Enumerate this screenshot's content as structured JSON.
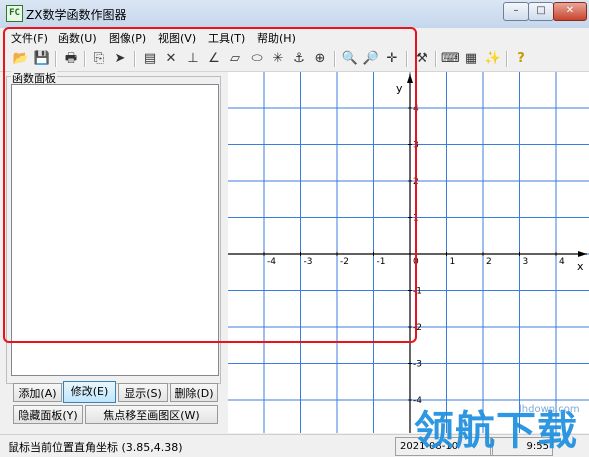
{
  "window": {
    "title": "ZX数学函数作图器",
    "app_icon_text": "FC",
    "min_glyph": "–",
    "max_glyph": "□",
    "close_glyph": "✕"
  },
  "menu": [
    "文件(F)",
    "函数(U)",
    "图像(P)",
    "视图(V)",
    "工具(T)",
    "帮助(H)"
  ],
  "toolbar": [
    {
      "icon": "open-folder-icon",
      "glyph": "📂"
    },
    {
      "icon": "save-icon",
      "glyph": "💾"
    },
    {
      "icon": "print-icon",
      "glyph": "🖶"
    },
    {
      "icon": "copy-icon",
      "glyph": "⎘"
    },
    {
      "icon": "export-icon",
      "glyph": "➤"
    },
    {
      "icon": "window-icon",
      "glyph": "▤"
    },
    {
      "icon": "intersect-icon",
      "glyph": "✕"
    },
    {
      "icon": "axis-icon",
      "glyph": "⊥"
    },
    {
      "icon": "angle-icon",
      "glyph": "∠"
    },
    {
      "icon": "parallelogram-icon",
      "glyph": "▱"
    },
    {
      "icon": "ellipse-icon",
      "glyph": "⬭"
    },
    {
      "icon": "asterisk-icon",
      "glyph": "✳"
    },
    {
      "icon": "anchor-icon",
      "glyph": "⚓"
    },
    {
      "icon": "target-icon",
      "glyph": "⊕"
    },
    {
      "icon": "zoom-in-icon",
      "glyph": "🔍"
    },
    {
      "icon": "zoom-out-icon",
      "glyph": "🔎"
    },
    {
      "icon": "crosshair-icon",
      "glyph": "✛"
    },
    {
      "icon": "tools-icon",
      "glyph": "⚒"
    },
    {
      "icon": "keyboard-icon",
      "glyph": "⌨"
    },
    {
      "icon": "table-icon",
      "glyph": "▦"
    },
    {
      "icon": "magic-wand-icon",
      "glyph": "✨"
    },
    {
      "icon": "help-icon",
      "glyph": "?"
    }
  ],
  "panel": {
    "label": "函数面板",
    "buttons": {
      "add": "添加(A)",
      "edit": "修改(E)",
      "show": "显示(S)",
      "delete": "删除(D)",
      "hide_panel": "隐藏面板(Y)",
      "focus_graph": "焦点移至画图区(W)"
    }
  },
  "graph": {
    "x_label": "x",
    "y_label": "y",
    "x_ticks": [
      "-4",
      "-3",
      "-2",
      "-1",
      "0",
      "1",
      "2",
      "3",
      "4"
    ],
    "y_ticks": [
      "4",
      "3",
      "2",
      "1",
      "-1",
      "-2",
      "-3",
      "-4"
    ],
    "x_range": [
      -5,
      4.5
    ],
    "y_range": [
      -4.5,
      5
    ],
    "grid": true,
    "grid_color": "#3b7ddd"
  },
  "status": {
    "coords": "鼠标当前位置直角坐标 (3.85,4.38)",
    "date": "2021-08-10",
    "time": "9:55"
  },
  "watermark": {
    "small": "lhdown.com",
    "big": "领航下载"
  }
}
